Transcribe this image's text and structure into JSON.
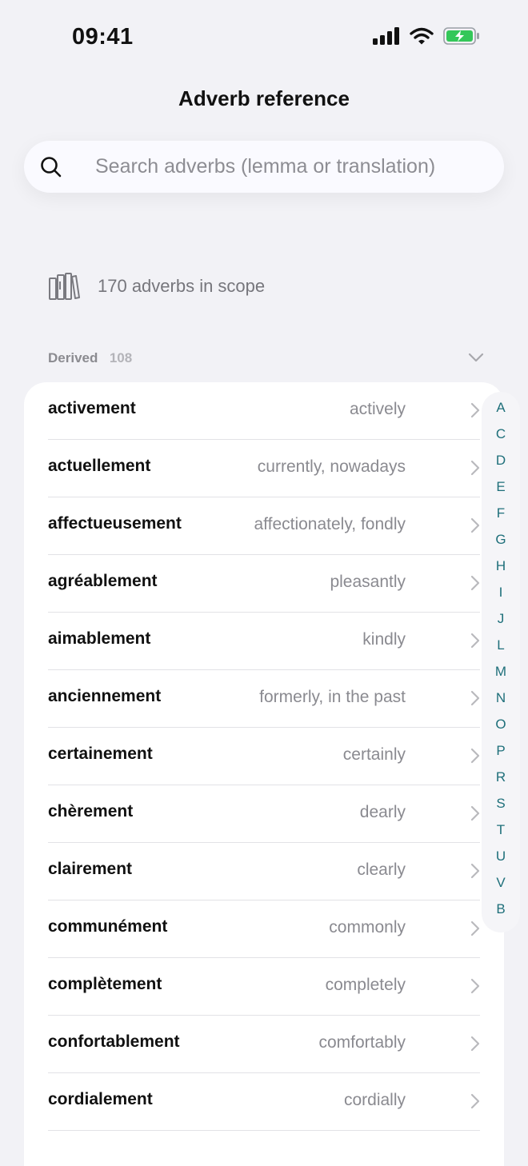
{
  "status": {
    "time": "09:41"
  },
  "nav": {
    "title": "Adverb reference"
  },
  "search": {
    "placeholder": "Search adverbs (lemma or translation)",
    "value": ""
  },
  "scope": {
    "text": "170 adverbs in scope"
  },
  "section": {
    "title": "Derived",
    "count": "108"
  },
  "rows": [
    {
      "lemma": "activement",
      "translation": "actively"
    },
    {
      "lemma": "actuellement",
      "translation": "currently, nowadays"
    },
    {
      "lemma": "affectueusement",
      "translation": "affectionately, fondly"
    },
    {
      "lemma": "agréablement",
      "translation": "pleasantly"
    },
    {
      "lemma": "aimablement",
      "translation": "kindly"
    },
    {
      "lemma": "anciennement",
      "translation": "formerly, in the past"
    },
    {
      "lemma": "certainement",
      "translation": "certainly"
    },
    {
      "lemma": "chèrement",
      "translation": "dearly"
    },
    {
      "lemma": "clairement",
      "translation": "clearly"
    },
    {
      "lemma": "communément",
      "translation": "commonly"
    },
    {
      "lemma": "complètement",
      "translation": "completely"
    },
    {
      "lemma": "confortablement",
      "translation": "comfortably"
    },
    {
      "lemma": "cordialement",
      "translation": "cordially"
    },
    {
      "lemma": "",
      "translation": ""
    }
  ],
  "index_letters": [
    "A",
    "C",
    "D",
    "E",
    "F",
    "G",
    "H",
    "I",
    "J",
    "L",
    "M",
    "N",
    "O",
    "P",
    "R",
    "S",
    "T",
    "U",
    "V",
    "B"
  ],
  "colors": {
    "accent": "#1e6f7a",
    "background": "#f2f2f6",
    "battery": "#34c759"
  },
  "icons": [
    "search-icon",
    "books-icon",
    "chevron-down-icon",
    "chevron-right-icon",
    "signal-icon",
    "wifi-icon",
    "battery-icon"
  ]
}
